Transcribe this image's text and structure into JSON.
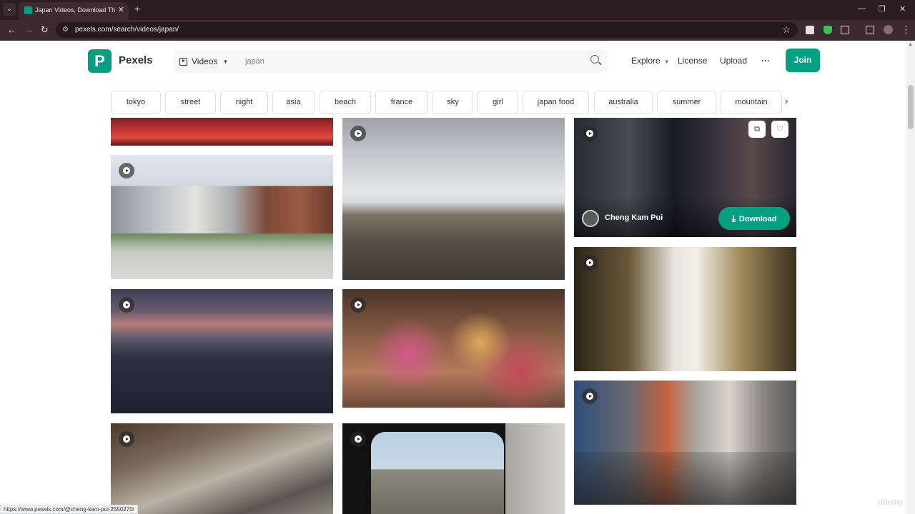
{
  "browser": {
    "tab_title": "Japan Videos, Download The Best",
    "tab_close": "✕",
    "new_tab": "+",
    "url": "pexels.com/search/videos/japan/",
    "status_url": "https://www.pexels.com/@cheng-kam-pui-2550270/"
  },
  "header": {
    "logo_letter": "P",
    "brand": "Pexels",
    "search_type": "Videos",
    "search_value": "japan",
    "nav": [
      "Explore",
      "License",
      "Upload",
      "···"
    ],
    "join": "Join"
  },
  "tags": [
    "tokyo",
    "street",
    "night",
    "asia",
    "beach",
    "france",
    "sky",
    "girl",
    "japan food",
    "australia",
    "summer",
    "mountain"
  ],
  "hover_card": {
    "author": "Cheng Kam Pui",
    "download_label": "Download"
  },
  "watermark": "ūdemy",
  "colors": {
    "brand": "#05a081",
    "chrome": "#3c2a30",
    "tab_strip": "#2b1d22"
  },
  "icons": {
    "search": "search-icon",
    "play": "play-icon",
    "bookmark": "bookmark-icon",
    "like": "heart-icon",
    "download": "download-icon"
  }
}
